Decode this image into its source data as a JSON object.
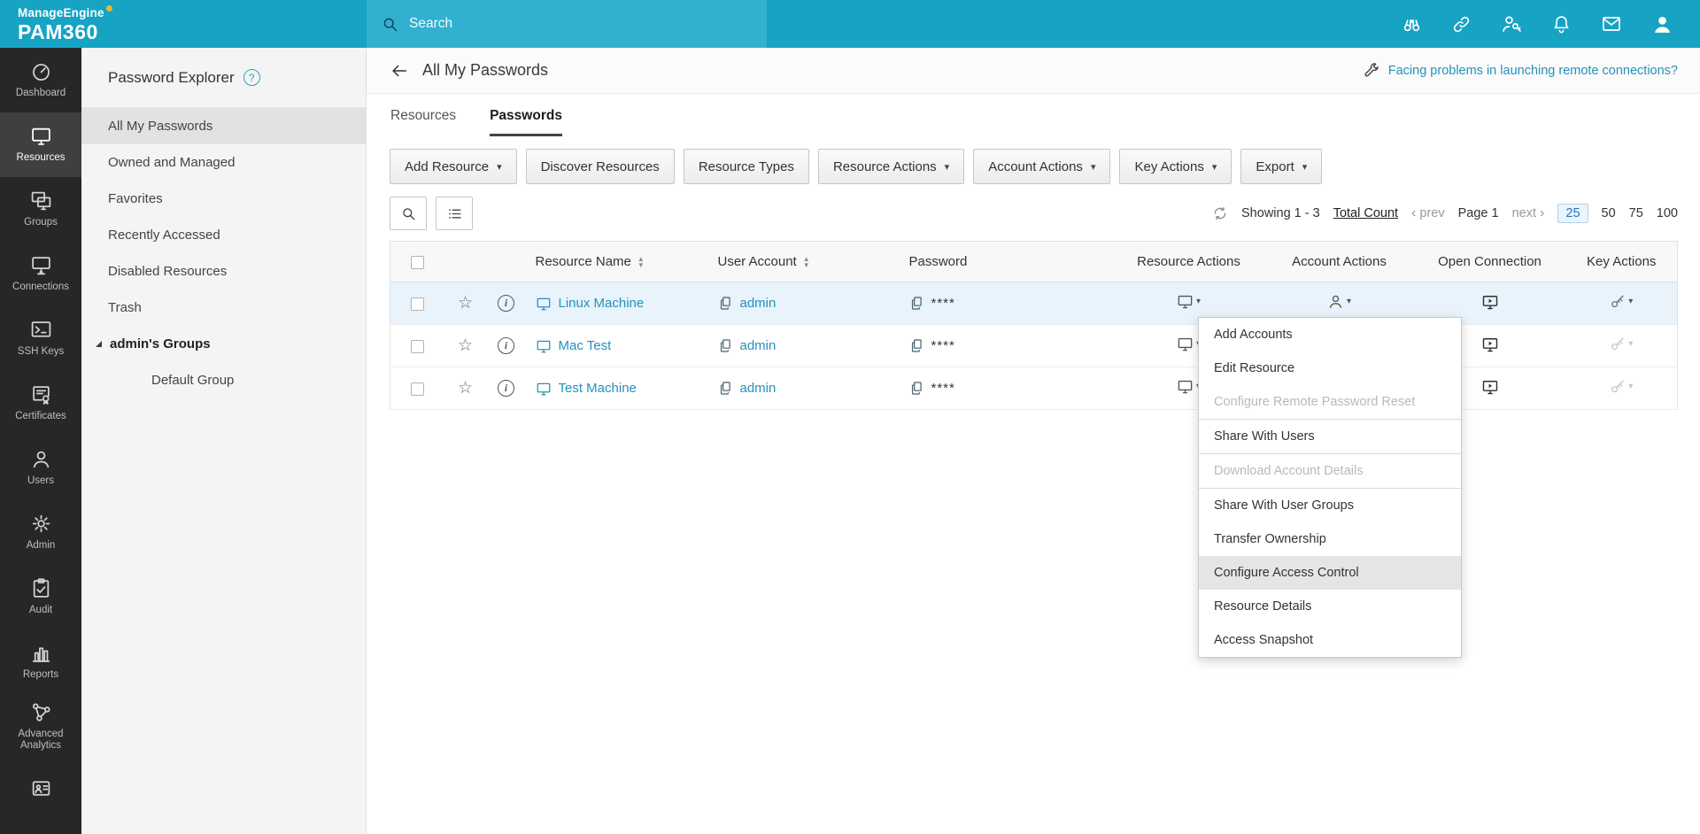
{
  "brand": {
    "line1": "ManageEngine",
    "line2": "PAM360"
  },
  "topbar": {
    "search_placeholder": "Search",
    "icons": [
      "resource-spotlight",
      "connections",
      "admin-access",
      "notifications",
      "mail",
      "user-profile"
    ]
  },
  "sidebar": {
    "items": [
      {
        "label": "Dashboard",
        "icon": "gauge-icon",
        "active": false
      },
      {
        "label": "Resources",
        "icon": "monitor-icon",
        "active": true
      },
      {
        "label": "Groups",
        "icon": "monitors-icon",
        "active": false
      },
      {
        "label": "Connections",
        "icon": "plug-icon",
        "active": false
      },
      {
        "label": "SSH Keys",
        "icon": "terminal-icon",
        "active": false
      },
      {
        "label": "Certificates",
        "icon": "certificate-icon",
        "active": false
      },
      {
        "label": "Users",
        "icon": "user-icon",
        "active": false
      },
      {
        "label": "Admin",
        "icon": "gear-icon",
        "active": false
      },
      {
        "label": "Audit",
        "icon": "clipboard-icon",
        "active": false
      },
      {
        "label": "Reports",
        "icon": "bar-chart-icon",
        "active": false
      },
      {
        "label": "Advanced Analytics",
        "icon": "nodes-icon",
        "active": false
      },
      {
        "label": "",
        "icon": "badge-icon",
        "active": false
      }
    ]
  },
  "explorer": {
    "title": "Password Explorer",
    "items": [
      {
        "label": "All My Passwords",
        "selected": true
      },
      {
        "label": "Owned and Managed",
        "selected": false
      },
      {
        "label": "Favorites",
        "selected": false
      },
      {
        "label": "Recently Accessed",
        "selected": false
      },
      {
        "label": "Disabled Resources",
        "selected": false
      },
      {
        "label": "Trash",
        "selected": false
      }
    ],
    "group": {
      "label": "admin's Groups",
      "children": [
        {
          "label": "Default Group"
        }
      ]
    }
  },
  "page": {
    "title": "All My Passwords",
    "help_link": "Facing problems in launching remote connections?",
    "tabs": [
      {
        "label": "Resources",
        "active": false
      },
      {
        "label": "Passwords",
        "active": true
      }
    ],
    "toolbar": [
      {
        "label": "Add Resource",
        "dropdown": true
      },
      {
        "label": "Discover Resources",
        "dropdown": false
      },
      {
        "label": "Resource Types",
        "dropdown": false
      },
      {
        "label": "Resource Actions",
        "dropdown": true
      },
      {
        "label": "Account Actions",
        "dropdown": true
      },
      {
        "label": "Key Actions",
        "dropdown": true
      },
      {
        "label": "Export",
        "dropdown": true
      }
    ],
    "pagination": {
      "showing": "Showing 1 - 3",
      "total_count_label": "Total Count",
      "prev_label": "prev",
      "page_label": "Page 1",
      "next_label": "next",
      "page_sizes": [
        "25",
        "50",
        "75",
        "100"
      ],
      "active_page_size": "25"
    }
  },
  "table": {
    "headers": {
      "resource": "Resource Name",
      "user": "User Account",
      "password": "Password",
      "resource_actions": "Resource Actions",
      "account_actions": "Account Actions",
      "open_connection": "Open Connection",
      "key_actions": "Key Actions"
    },
    "rows": [
      {
        "resource": "Linux Machine",
        "user": "admin",
        "password": "****",
        "selected": true
      },
      {
        "resource": "Mac Test",
        "user": "admin",
        "password": "****",
        "selected": false
      },
      {
        "resource": "Test Machine",
        "user": "admin",
        "password": "****",
        "selected": false
      }
    ]
  },
  "context_menu": {
    "items": [
      {
        "label": "Add Accounts",
        "disabled": false,
        "highlighted": false
      },
      {
        "label": "Edit Resource",
        "disabled": false,
        "highlighted": false
      },
      {
        "label": "Configure Remote Password Reset",
        "disabled": true,
        "highlighted": false
      },
      {
        "label": "Share With Users",
        "disabled": false,
        "highlighted": false
      },
      {
        "label": "Download Account Details",
        "disabled": true,
        "highlighted": false
      },
      {
        "label": "Share With User Groups",
        "disabled": false,
        "highlighted": false
      },
      {
        "label": "Transfer Ownership",
        "disabled": false,
        "highlighted": false
      },
      {
        "label": "Configure Access Control",
        "disabled": false,
        "highlighted": true
      },
      {
        "label": "Resource Details",
        "disabled": false,
        "highlighted": false
      },
      {
        "label": "Access Snapshot",
        "disabled": false,
        "highlighted": false
      }
    ]
  },
  "colors": {
    "topbar": "#16a3c4",
    "link": "#2492bb",
    "sidebar_bg": "#272727",
    "selected_row": "#e8f3fb"
  }
}
